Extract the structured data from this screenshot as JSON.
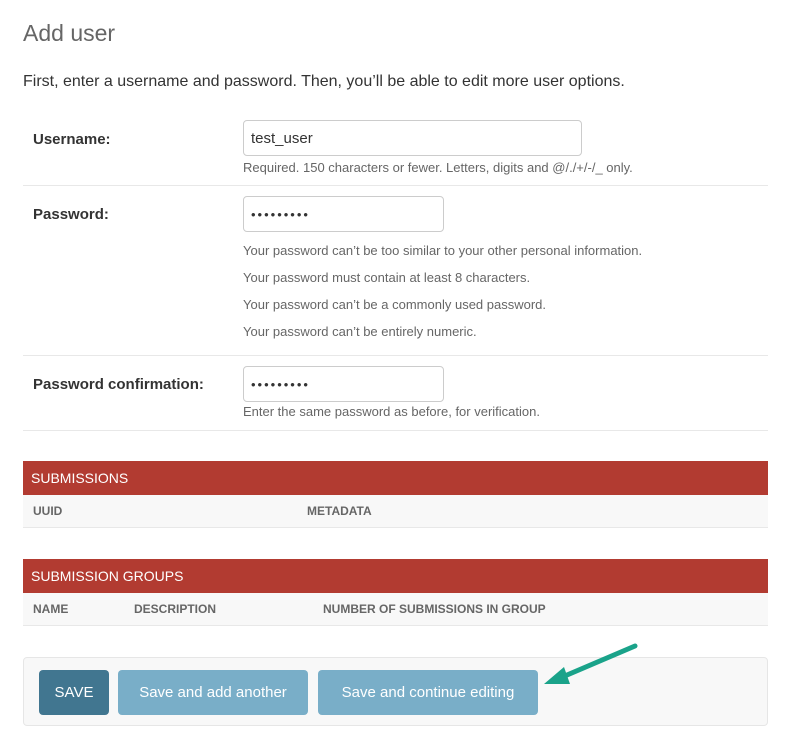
{
  "page": {
    "title": "Add user",
    "intro": "First, enter a username and password. Then, you’ll be able to edit more user options."
  },
  "form": {
    "username": {
      "label": "Username:",
      "value": "test_user",
      "help": "Required. 150 characters or fewer. Letters, digits and @/./+/-/_ only."
    },
    "password": {
      "label": "Password:",
      "value": "•••••••••",
      "help": [
        "Your password can’t be too similar to your other personal information.",
        "Your password must contain at least 8 characters.",
        "Your password can’t be a commonly used password.",
        "Your password can’t be entirely numeric."
      ]
    },
    "password_confirmation": {
      "label": "Password confirmation:",
      "value": "•••••••••",
      "help": "Enter the same password as before, for verification."
    }
  },
  "inlines": {
    "submissions": {
      "title": "SUBMISSIONS",
      "columns": [
        "UUID",
        "METADATA"
      ]
    },
    "submission_groups": {
      "title": "SUBMISSION GROUPS",
      "columns": [
        "NAME",
        "DESCRIPTION",
        "NUMBER OF SUBMISSIONS IN GROUP"
      ]
    }
  },
  "actions": {
    "save": "SAVE",
    "save_add_another": "Save and add another",
    "save_continue": "Save and continue editing"
  },
  "annotation": {
    "icon": "arrow-pointer-icon",
    "color": "#1aa38a"
  },
  "colors": {
    "inline_header": "#b23b31",
    "save_button": "#417690",
    "secondary_button": "#79aec8"
  }
}
